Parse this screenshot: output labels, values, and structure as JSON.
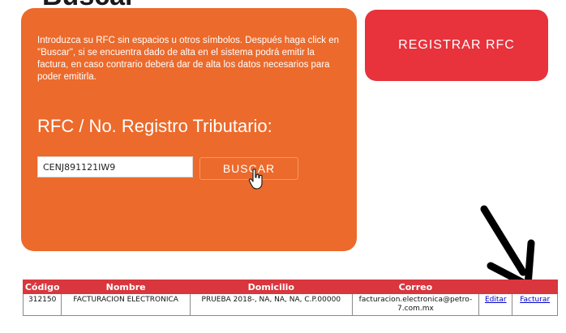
{
  "header": {
    "title_fragment": "Buscar"
  },
  "search_panel": {
    "instructions": "Introduzca su RFC sin espacios u otros símbolos. Después haga click en \"Buscar\", si se encuentra dado de alta en el sistema podrá emitir la factura, en caso contrario deberá dar de alta los datos necesarios para poder emitirla.",
    "rfc_label": "RFC / No. Registro Tributario:",
    "rfc_value": "CENJ891121IW9",
    "search_button": "BUSCAR"
  },
  "register_button": "REGISTRAR RFC",
  "results_table": {
    "headers": [
      "Código",
      "Nombre",
      "Domicilio",
      "Correo",
      "",
      ""
    ],
    "rows": [
      {
        "codigo": "312150",
        "nombre": "FACTURACION ELECTRONICA",
        "domicilio": "PRUEBA 2018-, NA, NA, NA, C.P.00000",
        "correo": "facturacion.electronica@petro-7.com.mx",
        "edit_link": "Editar",
        "invoice_link": "Facturar"
      }
    ]
  },
  "colors": {
    "orange_panel": "#ec6a2b",
    "register_red": "#e8323c",
    "table_header_red": "#d9363e",
    "link_blue": "#0000cc"
  },
  "icons": [
    "hand-cursor-icon",
    "arrow-icon"
  ]
}
